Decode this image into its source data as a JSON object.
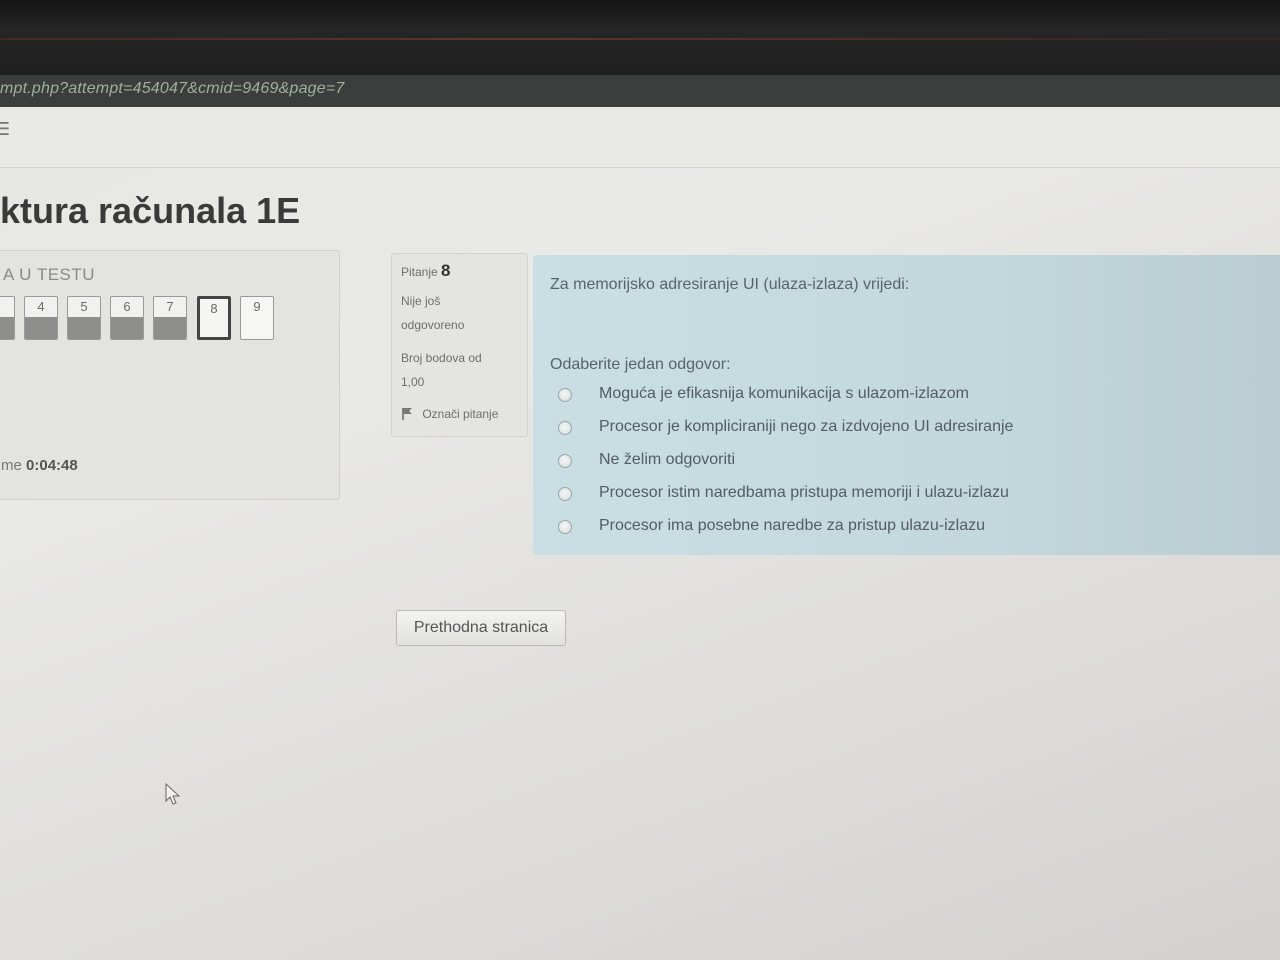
{
  "browser": {
    "url_fragment": "mpt.php?attempt=454047&cmid=9469&page=7"
  },
  "header": {
    "icon": "menu-icon"
  },
  "page": {
    "title": "ktura računala 1E"
  },
  "quiz_navigation": {
    "title": "A U TESTU",
    "buttons": [
      {
        "label": "",
        "state": "answered"
      },
      {
        "label": "4",
        "state": "answered"
      },
      {
        "label": "5",
        "state": "answered"
      },
      {
        "label": "6",
        "state": "answered"
      },
      {
        "label": "7",
        "state": "answered"
      },
      {
        "label": "8",
        "state": "current"
      },
      {
        "label": "9",
        "state": "unanswered"
      }
    ],
    "timer_label": "me",
    "timer_value": "0:04:48"
  },
  "question_info": {
    "label": "Pitanje",
    "number": "8",
    "status_line1": "Nije još",
    "status_line2": "odgovoreno",
    "points_line1": "Broj bodova od",
    "points_line2": "1,00",
    "flag_label": "Označi pitanje"
  },
  "question": {
    "text": "Za memorijsko adresiranje UI (ulaza-izlaza) vrijedi:",
    "prompt": "Odaberite jedan odgovor:",
    "answers": [
      "Moguća je efikasnija komunikacija s ulazom-izlazom",
      "Procesor je kompliciraniji nego za izdvojeno UI adresiranje",
      "Ne želim odgovoriti",
      "Procesor istim naredbama pristupa memoriji i ulazu-izlazu",
      "Procesor ima posebne naredbe za pristup ulazu-izlazu"
    ]
  },
  "footer": {
    "prev_button": "Prethodna stranica"
  },
  "colors": {
    "question_bg": "#c9dfe3",
    "nav_current_border": "#444444",
    "answered_fill": "#8e8e8c"
  }
}
